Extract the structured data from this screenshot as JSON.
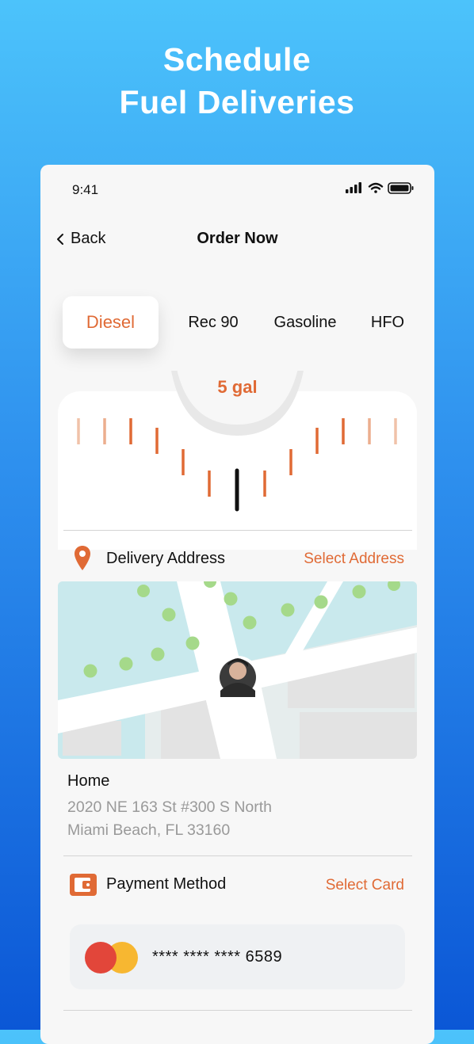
{
  "headline": {
    "line1": "Schedule",
    "line2": "Fuel Deliveries"
  },
  "status_bar": {
    "time": "9:41",
    "icons": [
      "signal-icon",
      "wifi-icon",
      "battery-icon"
    ]
  },
  "nav": {
    "back_label": "Back",
    "title": "Order Now"
  },
  "fuel_types": {
    "selected": "Diesel",
    "items": [
      {
        "label": "Diesel"
      },
      {
        "label": "Rec 90"
      },
      {
        "label": "Gasoline"
      },
      {
        "label": "HFO"
      }
    ]
  },
  "volume": {
    "label": "5 gal"
  },
  "delivery": {
    "title": "Delivery Address",
    "action": "Select Address",
    "address": {
      "name": "Home",
      "line1": "2020 NE 163 St #300 S North",
      "line2": "Miami Beach, FL 33160"
    }
  },
  "payment": {
    "title": "Payment Method",
    "action": "Select Card",
    "card": {
      "brand_icon": "mastercard-icon",
      "number": "**** **** **** 6589"
    }
  },
  "colors": {
    "accent": "#e06a35",
    "background_top": "#4cc3fb",
    "background_bottom": "#0b57d6",
    "card": "#f7f7f7",
    "map_base": "#e6eded",
    "map_park": "#c9e9ed",
    "map_dot": "#a5d98a"
  }
}
